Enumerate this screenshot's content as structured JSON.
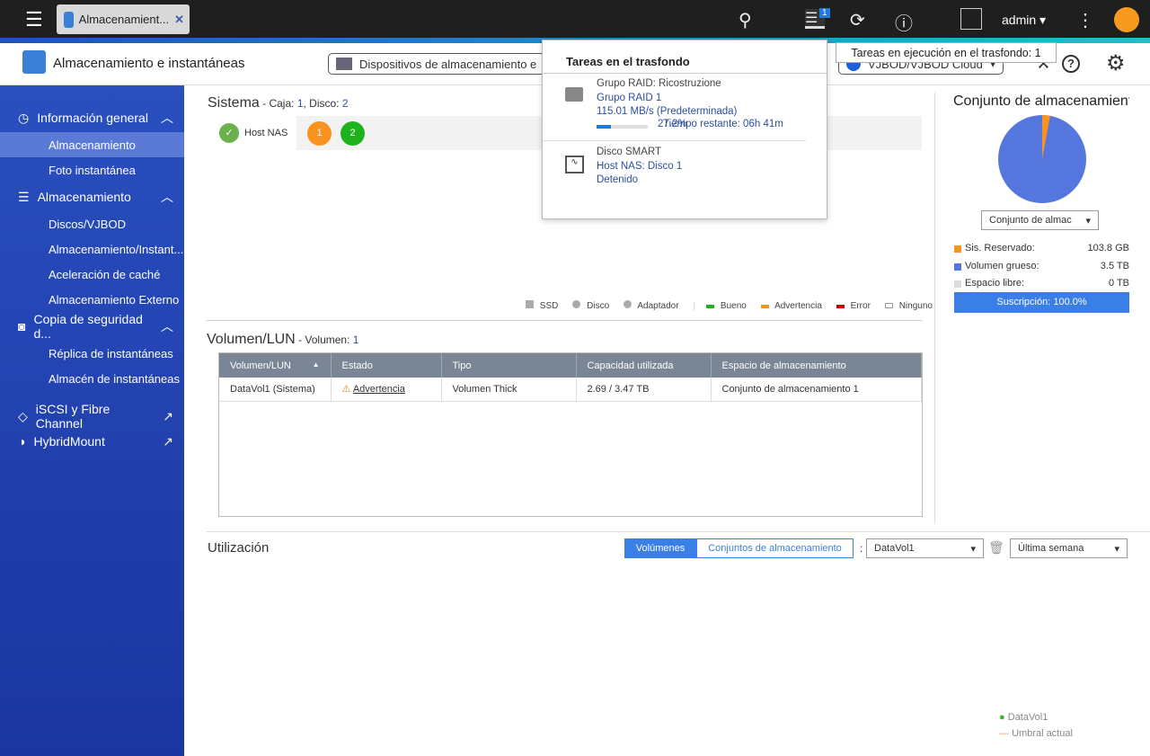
{
  "topbar": {
    "app_tab": "Almacenamient...",
    "tasks_badge": "1",
    "user": "admin",
    "tooltip": "Tareas en ejecución en el trasfondo: 1"
  },
  "header": {
    "title": "Almacenamiento e instantáneas",
    "device_select": "Dispositivos de almacenamiento e",
    "cloud_select": "VJBOD/VJBOD Cloud"
  },
  "sidebar": {
    "sections": [
      {
        "label": "Información general",
        "items": [
          "Almacenamiento",
          "Foto instantánea"
        ]
      },
      {
        "label": "Almacenamiento",
        "items": [
          "Discos/VJBOD",
          "Almacenamiento/Instant...",
          "Aceleración de caché",
          "Almacenamiento Externo"
        ]
      },
      {
        "label": "Copia de seguridad d...",
        "items": [
          "Réplica de instantáneas",
          "Almacén de instantáneas"
        ]
      },
      {
        "label": "iSCSI y Fibre Channel",
        "items": []
      },
      {
        "label": "HybridMount",
        "items": []
      }
    ]
  },
  "system": {
    "title": "Sistema",
    "caja_label": " - Caja: ",
    "caja": "1",
    "disco_label": ", Disco: ",
    "disco": "2",
    "host": "Host NAS",
    "disks": [
      {
        "n": "1",
        "color": "#f7931e"
      },
      {
        "n": "2",
        "color": "#1db31d"
      }
    ],
    "legend": [
      "SSD",
      "Disco",
      "Adaptador",
      "Bueno",
      "Advertencia",
      "Error",
      "Ninguno"
    ]
  },
  "volume": {
    "title": "Volumen/LUN",
    "sub": " - Volumen: ",
    "count": "1",
    "columns": [
      "Volumen/LUN",
      "Estado",
      "Tipo",
      "Capacidad utilizada",
      "Espacio de almacenamiento"
    ],
    "rows": [
      [
        "DataVol1 (Sistema)",
        "Advertencia",
        "Volumen Thick",
        "2.69 / 3.47 TB",
        "Conjunto de almacenamiento 1"
      ]
    ]
  },
  "pool": {
    "title": "Conjunto de almacenamiento",
    "select": "Conjunto de almac",
    "reserved_fraction": 0.029,
    "legend": [
      {
        "label": "Sis. Reservado:",
        "value": "103.8 GB",
        "color": "#f7931e"
      },
      {
        "label": "Volumen grueso:",
        "value": "3.5 TB",
        "color": "#5577dd"
      },
      {
        "label": "Espacio libre:",
        "value": "0 TB",
        "color": "#ddd"
      }
    ],
    "subscription": "Suscripción: 100.0%"
  },
  "utilization": {
    "title": "Utilización",
    "tabs": [
      "Volúmenes",
      "Conjuntos de almacenamiento"
    ],
    "volume_select": "DataVol1",
    "period_select": "Última semana",
    "legend": [
      "DataVol1",
      "Umbral actual"
    ]
  },
  "popup": {
    "title": "Tareas en el trasfondo",
    "tasks": [
      {
        "name": "Grupo RAID: Ricostruzione",
        "line1": "Grupo RAID 1",
        "line2": "115.01 MB/s (Predeterminada)",
        "progress": "27.2%",
        "progress_value": 27.2,
        "remaining": "Tiempo restante: 06h 41m"
      },
      {
        "name": "Disco SMART",
        "line1": "Host NAS: Disco 1",
        "line2": "Detenido"
      }
    ]
  }
}
